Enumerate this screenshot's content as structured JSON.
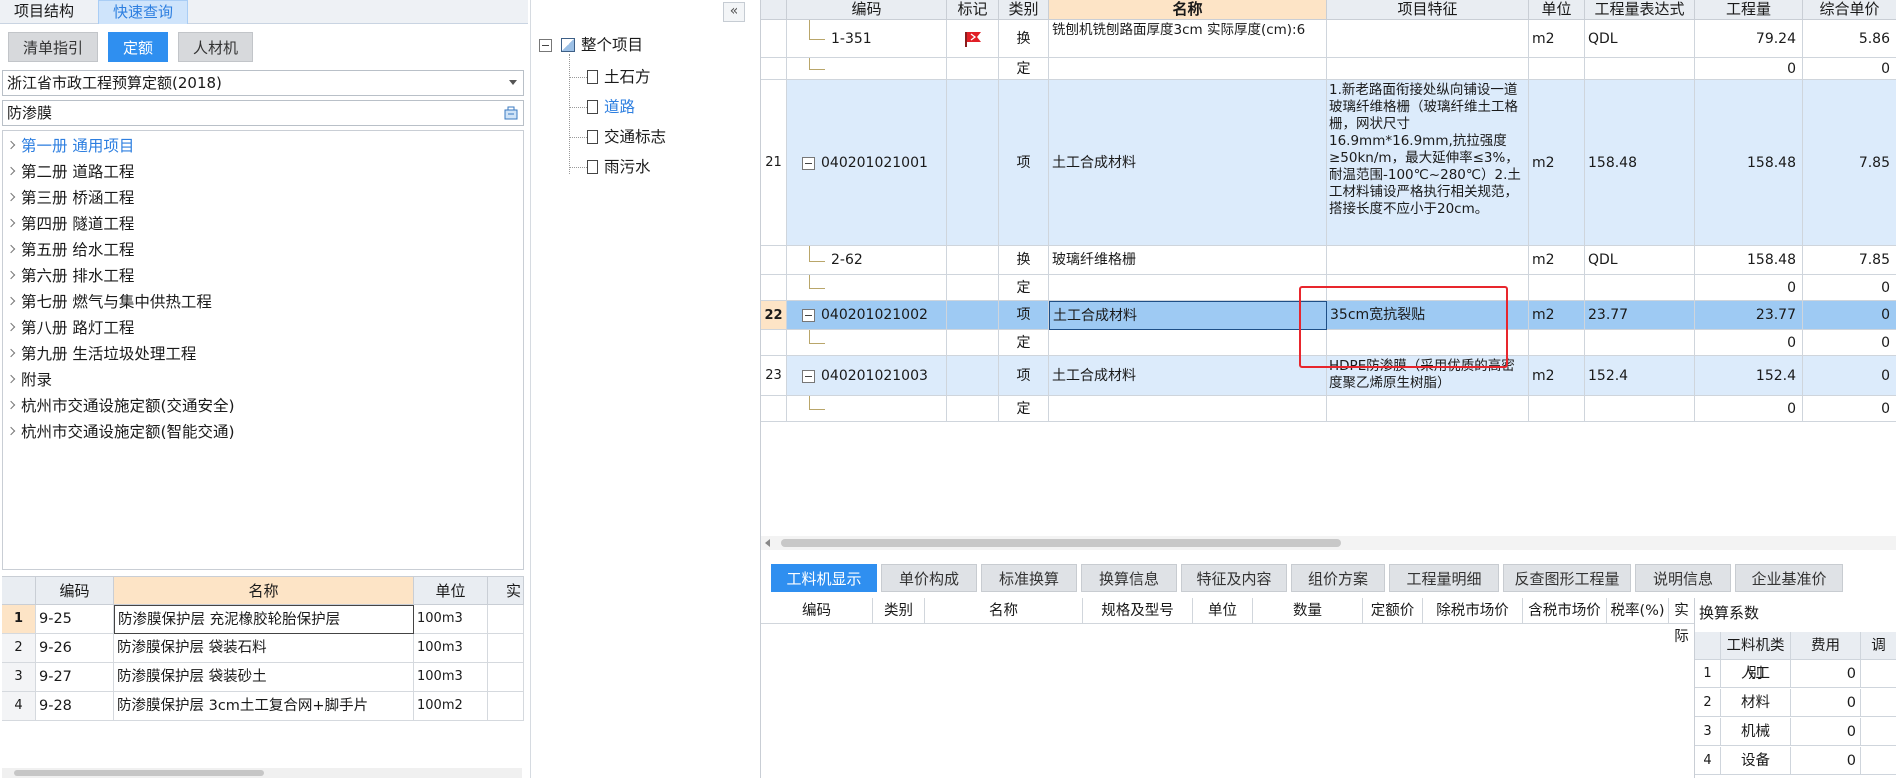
{
  "left": {
    "top_tabs": [
      "项目结构",
      "快速查询"
    ],
    "sub_tabs": [
      "清单指引",
      "定额",
      "人材机"
    ],
    "norm_select": "浙江省市政工程预算定额(2018)",
    "search_value": "防渗膜",
    "tree": [
      "第一册 通用项目",
      "第二册 道路工程",
      "第三册 桥涵工程",
      "第四册 隧道工程",
      "第五册 给水工程",
      "第六册 排水工程",
      "第七册 燃气与集中供热工程",
      "第八册 路灯工程",
      "第九册 生活垃圾处理工程",
      "附录",
      "杭州市交通设施定额(交通安全)",
      "杭州市交通设施定额(智能交通)"
    ],
    "grid_headers": [
      "编码",
      "名称",
      "单位",
      "实"
    ],
    "grid_rows": [
      {
        "no": "1",
        "code": "9-25",
        "name": "防渗膜保护层 充泥橡胶轮胎保护层",
        "unit": "100m3"
      },
      {
        "no": "2",
        "code": "9-26",
        "name": "防渗膜保护层 袋装石料",
        "unit": "100m3"
      },
      {
        "no": "3",
        "code": "9-27",
        "name": "防渗膜保护层 袋装砂土",
        "unit": "100m3"
      },
      {
        "no": "4",
        "code": "9-28",
        "name": "防渗膜保护层 3cm土工复合网+脚手片",
        "unit": "100m2"
      }
    ]
  },
  "middle": {
    "collapse_label": "«",
    "root": "整个项目",
    "children": [
      "土石方",
      "道路",
      "交通标志",
      "雨污水"
    ]
  },
  "grid": {
    "headers": [
      "编码",
      "标记",
      "类别",
      "名称",
      "项目特征",
      "单位",
      "工程量表达式",
      "工程量",
      "综合单价"
    ],
    "rows": [
      {
        "no": "",
        "code": "1-351",
        "cat": "换",
        "name": "铣刨机铣刨路面厚度3cm  实际厚度(cm):6",
        "feature": "",
        "unit": "m2",
        "expr": "QDL",
        "qty": "79.24",
        "price": "5.86"
      },
      {
        "no": "",
        "code": "",
        "cat": "定",
        "name": "",
        "feature": "",
        "unit": "",
        "expr": "",
        "qty": "0",
        "price": "0"
      },
      {
        "no": "21",
        "code": "040201021001",
        "cat": "项",
        "name": "土工合成材料",
        "feature": "1.新老路面衔接处纵向铺设一道玻璃纤维格栅（玻璃纤维土工格栅，网状尺寸16.9mm*16.9mm,抗拉强度≥50kn/m，最大延伸率≤3%，耐温范围-100℃~280℃）2.土工材料铺设严格执行相关规范，搭接长度不应小于20cm。",
        "unit": "m2",
        "expr": "158.48",
        "qty": "158.48",
        "price": "7.85"
      },
      {
        "no": "",
        "code": "2-62",
        "cat": "换",
        "name": "玻璃纤维格栅",
        "feature": "",
        "unit": "m2",
        "expr": "QDL",
        "qty": "158.48",
        "price": "7.85"
      },
      {
        "no": "",
        "code": "",
        "cat": "定",
        "name": "",
        "feature": "",
        "unit": "",
        "expr": "",
        "qty": "0",
        "price": "0"
      },
      {
        "no": "22",
        "code": "040201021002",
        "cat": "项",
        "name": "土工合成材料",
        "feature": "35cm宽抗裂贴",
        "unit": "m2",
        "expr": "23.77",
        "qty": "23.77",
        "price": "0"
      },
      {
        "no": "",
        "code": "",
        "cat": "定",
        "name": "",
        "feature": "",
        "unit": "",
        "expr": "",
        "qty": "0",
        "price": "0"
      },
      {
        "no": "23",
        "code": "040201021003",
        "cat": "项",
        "name": "土工合成材料",
        "feature": "HDPE防渗膜（采用优质的高密度聚乙烯原生树脂）",
        "unit": "m2",
        "expr": "152.4",
        "qty": "152.4",
        "price": "0"
      },
      {
        "no": "",
        "code": "",
        "cat": "定",
        "name": "",
        "feature": "",
        "unit": "",
        "expr": "",
        "qty": "0",
        "price": "0"
      }
    ]
  },
  "bottom": {
    "tabs": [
      "工料机显示",
      "单价构成",
      "标准换算",
      "换算信息",
      "特征及内容",
      "组价方案",
      "工程量明细",
      "反查图形工程量",
      "说明信息",
      "企业基准价"
    ],
    "headers": [
      "编码",
      "类别",
      "名称",
      "规格及型号",
      "单位",
      "数量",
      "定额价",
      "除税市场价",
      "含税市场价",
      "税率(%)",
      "实际"
    ],
    "coef": {
      "title": "换算系数",
      "headers": [
        "工料机类别",
        "费用",
        "调"
      ],
      "rows": [
        {
          "no": "1",
          "type": "人工",
          "val": "0"
        },
        {
          "no": "2",
          "type": "材料",
          "val": "0"
        },
        {
          "no": "3",
          "type": "机械",
          "val": "0"
        },
        {
          "no": "4",
          "type": "设备",
          "val": "0"
        }
      ]
    }
  },
  "colors": {
    "accent": "#2f8ff0",
    "selected_row": "#9ecaf3",
    "row_blue": "#dcebfb",
    "highlight_header": "#fde4c6",
    "annotation_red": "#e8262d"
  }
}
